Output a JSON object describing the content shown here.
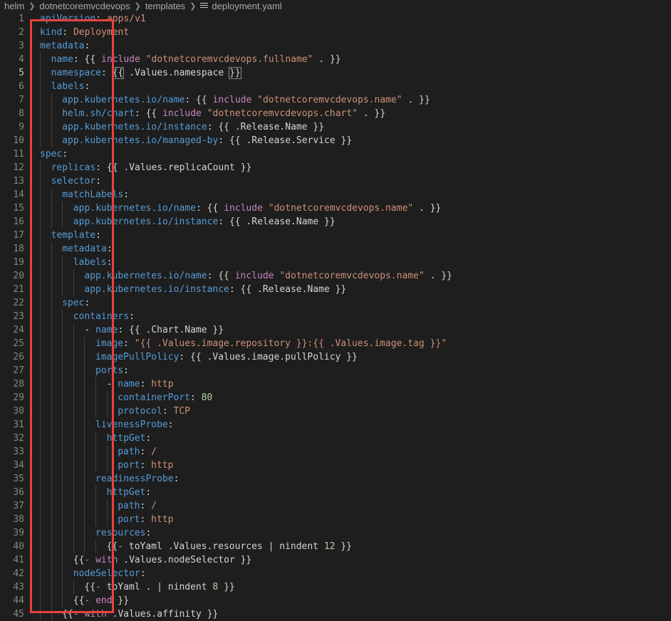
{
  "breadcrumb": {
    "items": [
      "helm",
      "dotnetcoremvcdevops",
      "templates"
    ],
    "file": "deployment.yaml",
    "icon": "file-lines-icon"
  },
  "editor": {
    "active_line": 5,
    "lines": [
      {
        "n": "1",
        "indent": 0,
        "tokens": [
          [
            "k",
            "apiVersion"
          ],
          [
            "t",
            ": "
          ],
          [
            "s",
            "apps/v1"
          ]
        ]
      },
      {
        "n": "2",
        "indent": 0,
        "tokens": [
          [
            "k",
            "kind"
          ],
          [
            "t",
            ": "
          ],
          [
            "s",
            "Deployment"
          ]
        ]
      },
      {
        "n": "3",
        "indent": 0,
        "tokens": [
          [
            "k",
            "metadata"
          ],
          [
            "t",
            ":"
          ]
        ]
      },
      {
        "n": "4",
        "indent": 1,
        "tokens": [
          [
            "k",
            "name"
          ],
          [
            "t",
            ": {{ "
          ],
          [
            "kw",
            "include"
          ],
          [
            "t",
            " "
          ],
          [
            "s",
            "\"dotnetcoremvcdevops.fullname\""
          ],
          [
            "t",
            " . }}"
          ]
        ]
      },
      {
        "n": "5",
        "indent": 1,
        "tokens": [
          [
            "k",
            "namespace"
          ],
          [
            "t",
            ": "
          ],
          [
            "box",
            "{{"
          ],
          [
            "t",
            " .Values.namespace "
          ],
          [
            "box",
            "}}"
          ]
        ]
      },
      {
        "n": "6",
        "indent": 1,
        "tokens": [
          [
            "k",
            "labels"
          ],
          [
            "t",
            ":"
          ]
        ]
      },
      {
        "n": "7",
        "indent": 2,
        "tokens": [
          [
            "k",
            "app.kubernetes.io/name"
          ],
          [
            "t",
            ": {{ "
          ],
          [
            "kw",
            "include"
          ],
          [
            "t",
            " "
          ],
          [
            "s",
            "\"dotnetcoremvcdevops.name\""
          ],
          [
            "t",
            " . }}"
          ]
        ]
      },
      {
        "n": "8",
        "indent": 2,
        "tokens": [
          [
            "k",
            "helm.sh/chart"
          ],
          [
            "t",
            ": {{ "
          ],
          [
            "kw",
            "include"
          ],
          [
            "t",
            " "
          ],
          [
            "s",
            "\"dotnetcoremvcdevops.chart\""
          ],
          [
            "t",
            " . }}"
          ]
        ]
      },
      {
        "n": "9",
        "indent": 2,
        "tokens": [
          [
            "k",
            "app.kubernetes.io/instance"
          ],
          [
            "t",
            ": {{ .Release.Name }}"
          ]
        ]
      },
      {
        "n": "10",
        "indent": 2,
        "tokens": [
          [
            "k",
            "app.kubernetes.io/managed-by"
          ],
          [
            "t",
            ": {{ .Release.Service }}"
          ]
        ]
      },
      {
        "n": "11",
        "indent": 0,
        "tokens": [
          [
            "k",
            "spec"
          ],
          [
            "t",
            ":"
          ]
        ]
      },
      {
        "n": "12",
        "indent": 1,
        "tokens": [
          [
            "k",
            "replicas"
          ],
          [
            "t",
            ": {{ .Values.replicaCount }}"
          ]
        ]
      },
      {
        "n": "13",
        "indent": 1,
        "tokens": [
          [
            "k",
            "selector"
          ],
          [
            "t",
            ":"
          ]
        ]
      },
      {
        "n": "14",
        "indent": 2,
        "tokens": [
          [
            "k",
            "matchLabels"
          ],
          [
            "t",
            ":"
          ]
        ]
      },
      {
        "n": "15",
        "indent": 3,
        "tokens": [
          [
            "k",
            "app.kubernetes.io/name"
          ],
          [
            "t",
            ": {{ "
          ],
          [
            "kw",
            "include"
          ],
          [
            "t",
            " "
          ],
          [
            "s",
            "\"dotnetcoremvcdevops.name\""
          ],
          [
            "t",
            " . }}"
          ]
        ]
      },
      {
        "n": "16",
        "indent": 3,
        "tokens": [
          [
            "k",
            "app.kubernetes.io/instance"
          ],
          [
            "t",
            ": {{ .Release.Name }}"
          ]
        ]
      },
      {
        "n": "17",
        "indent": 1,
        "tokens": [
          [
            "k",
            "template"
          ],
          [
            "t",
            ":"
          ]
        ]
      },
      {
        "n": "18",
        "indent": 2,
        "tokens": [
          [
            "k",
            "metadata"
          ],
          [
            "t",
            ":"
          ]
        ]
      },
      {
        "n": "19",
        "indent": 3,
        "tokens": [
          [
            "k",
            "labels"
          ],
          [
            "t",
            ":"
          ]
        ]
      },
      {
        "n": "20",
        "indent": 4,
        "tokens": [
          [
            "k",
            "app.kubernetes.io/name"
          ],
          [
            "t",
            ": {{ "
          ],
          [
            "kw",
            "include"
          ],
          [
            "t",
            " "
          ],
          [
            "s",
            "\"dotnetcoremvcdevops.name\""
          ],
          [
            "t",
            " . }}"
          ]
        ]
      },
      {
        "n": "21",
        "indent": 4,
        "tokens": [
          [
            "k",
            "app.kubernetes.io/instance"
          ],
          [
            "t",
            ": {{ .Release.Name }}"
          ]
        ]
      },
      {
        "n": "22",
        "indent": 2,
        "tokens": [
          [
            "k",
            "spec"
          ],
          [
            "t",
            ":"
          ]
        ]
      },
      {
        "n": "23",
        "indent": 3,
        "tokens": [
          [
            "k",
            "containers"
          ],
          [
            "t",
            ":"
          ]
        ]
      },
      {
        "n": "24",
        "indent": 4,
        "tokens": [
          [
            "t",
            "- "
          ],
          [
            "k",
            "name"
          ],
          [
            "t",
            ": {{ .Chart.Name }}"
          ]
        ]
      },
      {
        "n": "25",
        "indent": 5,
        "tokens": [
          [
            "k",
            "image"
          ],
          [
            "t",
            ": "
          ],
          [
            "s",
            "\"{{ .Values.image.repository }}:{{ .Values.image.tag }}\""
          ]
        ]
      },
      {
        "n": "26",
        "indent": 5,
        "tokens": [
          [
            "k",
            "imagePullPolicy"
          ],
          [
            "t",
            ": {{ .Values.image.pullPolicy }}"
          ]
        ]
      },
      {
        "n": "27",
        "indent": 5,
        "tokens": [
          [
            "k",
            "ports"
          ],
          [
            "t",
            ":"
          ]
        ]
      },
      {
        "n": "28",
        "indent": 6,
        "tokens": [
          [
            "t",
            "- "
          ],
          [
            "k",
            "name"
          ],
          [
            "t",
            ": "
          ],
          [
            "s",
            "http"
          ]
        ]
      },
      {
        "n": "29",
        "indent": 7,
        "tokens": [
          [
            "k",
            "containerPort"
          ],
          [
            "t",
            ": "
          ],
          [
            "n",
            "80"
          ]
        ]
      },
      {
        "n": "30",
        "indent": 7,
        "tokens": [
          [
            "k",
            "protocol"
          ],
          [
            "t",
            ": "
          ],
          [
            "s",
            "TCP"
          ]
        ]
      },
      {
        "n": "31",
        "indent": 5,
        "tokens": [
          [
            "k",
            "livenessProbe"
          ],
          [
            "t",
            ":"
          ]
        ]
      },
      {
        "n": "32",
        "indent": 6,
        "tokens": [
          [
            "k",
            "httpGet"
          ],
          [
            "t",
            ":"
          ]
        ]
      },
      {
        "n": "33",
        "indent": 7,
        "tokens": [
          [
            "k",
            "path"
          ],
          [
            "t",
            ": "
          ],
          [
            "s",
            "/"
          ]
        ]
      },
      {
        "n": "34",
        "indent": 7,
        "tokens": [
          [
            "k",
            "port"
          ],
          [
            "t",
            ": "
          ],
          [
            "s",
            "http"
          ]
        ]
      },
      {
        "n": "35",
        "indent": 5,
        "tokens": [
          [
            "k",
            "readinessProbe"
          ],
          [
            "t",
            ":"
          ]
        ]
      },
      {
        "n": "36",
        "indent": 6,
        "tokens": [
          [
            "k",
            "httpGet"
          ],
          [
            "t",
            ":"
          ]
        ]
      },
      {
        "n": "37",
        "indent": 7,
        "tokens": [
          [
            "k",
            "path"
          ],
          [
            "t",
            ": "
          ],
          [
            "s",
            "/"
          ]
        ]
      },
      {
        "n": "38",
        "indent": 7,
        "tokens": [
          [
            "k",
            "port"
          ],
          [
            "t",
            ": "
          ],
          [
            "s",
            "http"
          ]
        ]
      },
      {
        "n": "39",
        "indent": 5,
        "tokens": [
          [
            "k",
            "resources"
          ],
          [
            "t",
            ":"
          ]
        ]
      },
      {
        "n": "40",
        "indent": 6,
        "tokens": [
          [
            "t",
            "{{"
          ],
          [
            "kw",
            "-"
          ],
          [
            "t",
            " toYaml .Values.resources | nindent "
          ],
          [
            "n",
            "12"
          ],
          [
            "t",
            " }}"
          ]
        ]
      },
      {
        "n": "41",
        "indent": 3,
        "tokens": [
          [
            "t",
            "{{"
          ],
          [
            "kw",
            "- with"
          ],
          [
            "t",
            " .Values.nodeSelector }}"
          ]
        ]
      },
      {
        "n": "42",
        "indent": 3,
        "tokens": [
          [
            "k",
            "nodeSelector"
          ],
          [
            "t",
            ":"
          ]
        ]
      },
      {
        "n": "43",
        "indent": 4,
        "tokens": [
          [
            "t",
            "{{"
          ],
          [
            "kw",
            "-"
          ],
          [
            "t",
            " toYaml . | nindent "
          ],
          [
            "n",
            "8"
          ],
          [
            "t",
            " }}"
          ]
        ]
      },
      {
        "n": "44",
        "indent": 3,
        "tokens": [
          [
            "t",
            "{{"
          ],
          [
            "kw",
            "- end"
          ],
          [
            "t",
            " }}"
          ]
        ]
      },
      {
        "n": "45",
        "indent": 2,
        "tokens": [
          [
            "t",
            "{{"
          ],
          [
            "kw",
            "- with"
          ],
          [
            "t",
            " .Values.affinity }}"
          ]
        ]
      }
    ]
  },
  "colors": {
    "background": "#1e1e1e",
    "key": "#569cd6",
    "string": "#ce9178",
    "keyword": "#c586c0",
    "number": "#b5cea8",
    "annotation": "#e8423f"
  }
}
